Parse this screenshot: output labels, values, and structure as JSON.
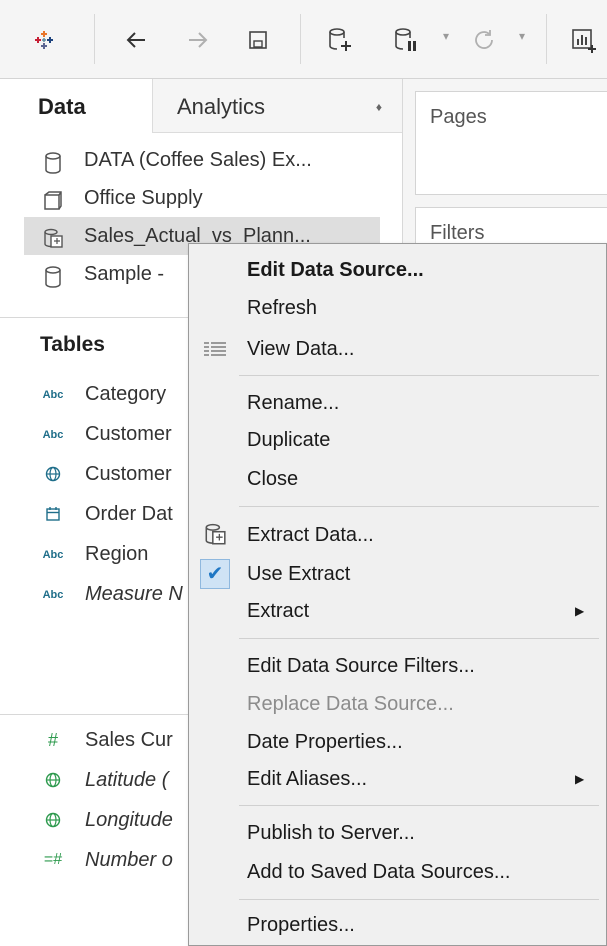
{
  "toolbar": {
    "buttons": [
      "tableau-logo-icon",
      "back-arrow-icon",
      "forward-arrow-icon",
      "save-icon",
      "new-data-source-icon",
      "pause-auto-updates-icon",
      "refresh-icon",
      "show-me-icon"
    ]
  },
  "tabs": {
    "data": "Data",
    "analytics": "Analytics",
    "analytics_sort": "♦"
  },
  "data_sources": [
    {
      "name": "DATA (Coffee Sales) Ex...",
      "icon": "database-icon"
    },
    {
      "name": "Office Supply",
      "icon": "cube-icon"
    },
    {
      "name": "Sales_Actual_vs_Plann...",
      "icon": "extract-database-icon",
      "selected": true
    },
    {
      "name": "Sample - ",
      "icon": "database-icon"
    }
  ],
  "tables": {
    "heading": "Tables",
    "dimensions": [
      {
        "type": "Abc",
        "name": "Category",
        "italic": false
      },
      {
        "type": "Abc",
        "name": "Customer",
        "italic": false
      },
      {
        "type": "globe",
        "name": "Customer",
        "italic": false
      },
      {
        "type": "calendar",
        "name": "Order Dat",
        "italic": false
      },
      {
        "type": "Abc",
        "name": "Region",
        "italic": false
      },
      {
        "type": "Abc",
        "name": "Measure N",
        "italic": true
      }
    ],
    "measures": [
      {
        "type": "#",
        "name": "Sales Cur",
        "italic": false
      },
      {
        "type": "globe",
        "name": "Latitude (",
        "italic": true
      },
      {
        "type": "globe",
        "name": "Longitude",
        "italic": true
      },
      {
        "type": "=#",
        "name": "Number o",
        "italic": true
      }
    ]
  },
  "shelves": {
    "pages": "Pages",
    "filters": "Filters"
  },
  "menu": {
    "items": [
      {
        "label": "Edit Data Source...",
        "bold": true
      },
      {
        "label": "Refresh"
      },
      {
        "label": "View Data...",
        "icon": "view-data-icon"
      },
      {
        "label": "Rename..."
      },
      {
        "label": "Duplicate"
      },
      {
        "label": "Close"
      },
      {
        "label": "Extract Data...",
        "icon": "extract-icon"
      },
      {
        "label": "Use Extract",
        "checked": true
      },
      {
        "label": "Extract",
        "submenu": true
      },
      {
        "label": "Edit Data Source Filters..."
      },
      {
        "label": "Replace Data Source...",
        "disabled": true
      },
      {
        "label": "Date Properties..."
      },
      {
        "label": "Edit Aliases...",
        "submenu": true
      },
      {
        "label": "Publish to Server..."
      },
      {
        "label": "Add to Saved Data Sources..."
      },
      {
        "label": "Properties..."
      }
    ],
    "submenu_arrow": "▶",
    "check_mark": "✔"
  },
  "colors": {
    "accent": "#1f77c4",
    "abc": "#1f6e8a",
    "measure_green": "#2e9a4e",
    "selected_row": "#dedede"
  }
}
